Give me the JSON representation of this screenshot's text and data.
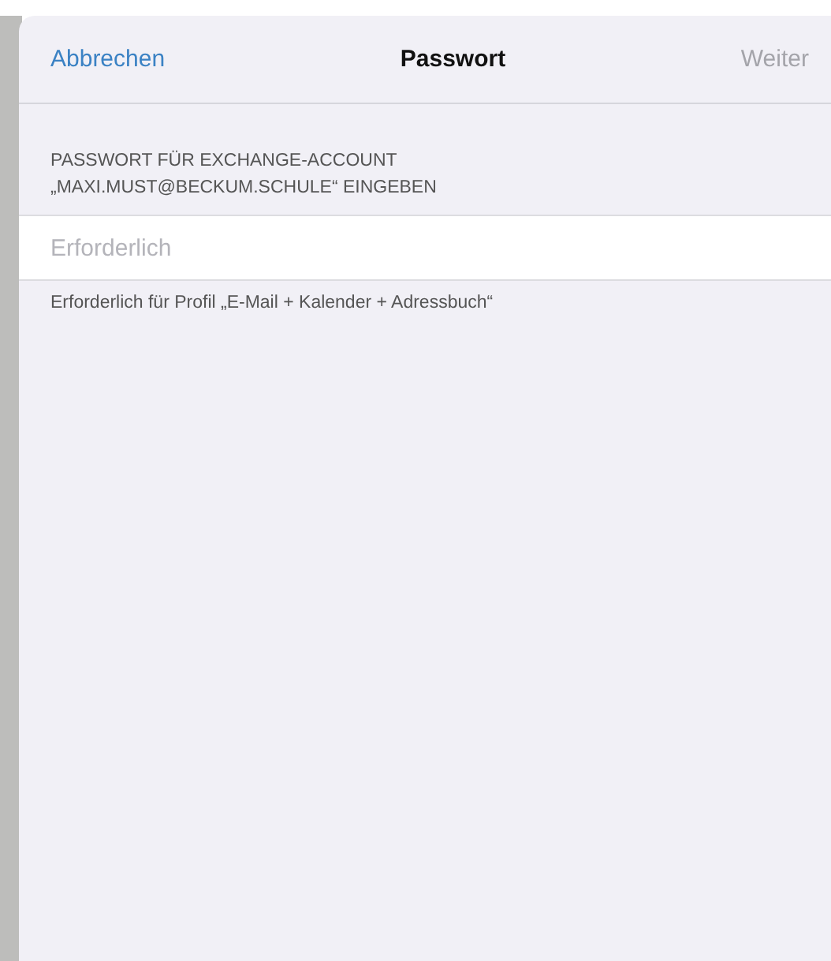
{
  "nav": {
    "cancel": "Abbrechen",
    "title": "Passwort",
    "next": "Weiter",
    "next_disabled": true
  },
  "section": {
    "header": "PASSWORT FÜR EXCHANGE-ACCOUNT „MAXI.MUST@BECKUM.SCHULE“ EINGEBEN",
    "field": {
      "placeholder": "Erforderlich"
    },
    "footer": "Erforderlich für Profil „E-Mail + Kalender + Adressbuch“"
  }
}
